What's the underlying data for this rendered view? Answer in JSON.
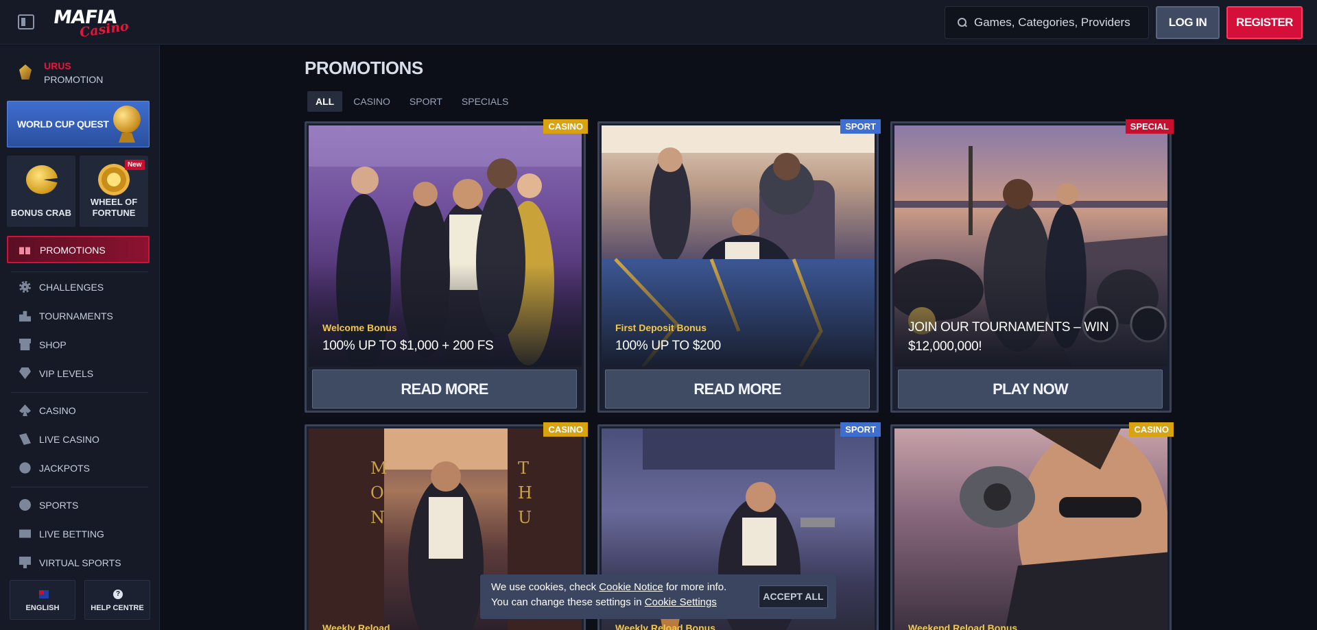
{
  "header": {
    "logo_main": "MAFIA",
    "logo_sub": "Casino",
    "search_placeholder": "Games, Categories, Providers",
    "login_label": "LOG IN",
    "register_label": "REGISTER"
  },
  "sidebar": {
    "urus_line1": "URUS",
    "urus_line2": "PROMOTION",
    "world_cup_quest": "WORLD CUP QUEST",
    "bonus_crab": "BONUS CRAB",
    "wheel_of_fortune_1": "WHEEL OF",
    "wheel_of_fortune_2": "FORTUNE",
    "new_badge": "New",
    "promotions": "PROMOTIONS",
    "items": [
      {
        "label": "CHALLENGES",
        "icon": "gear-icon"
      },
      {
        "label": "TOURNAMENTS",
        "icon": "podium-icon"
      },
      {
        "label": "SHOP",
        "icon": "shop-icon"
      },
      {
        "label": "VIP LEVELS",
        "icon": "diamond-icon"
      },
      {
        "label": "CASINO",
        "icon": "spade-icon"
      },
      {
        "label": "LIVE CASINO",
        "icon": "cards-icon"
      },
      {
        "label": "JACKPOTS",
        "icon": "clover-icon"
      },
      {
        "label": "SPORTS",
        "icon": "soccer-ball-icon"
      },
      {
        "label": "LIVE BETTING",
        "icon": "live-tv-icon"
      },
      {
        "label": "VIRTUAL SPORTS",
        "icon": "monitor-icon"
      }
    ],
    "language": "ENGLISH",
    "help": "HELP CENTRE",
    "help_glyph": "?"
  },
  "main": {
    "title": "PROMOTIONS",
    "tabs": [
      "ALL",
      "CASINO",
      "SPORT",
      "SPECIALS"
    ],
    "cards": [
      {
        "tag": "CASINO",
        "subtitle": "Welcome Bonus",
        "headline": "100% UP TO $1,000 + 200 FS",
        "cta": "READ MORE"
      },
      {
        "tag": "SPORT",
        "subtitle": "First Deposit Bonus",
        "headline": "100% UP TO $200",
        "cta": "READ MORE"
      },
      {
        "tag": "SPECIAL",
        "subtitle": "",
        "headline": "JOIN OUR TOURNAMENTS – WIN $12,000,000!",
        "cta": "PLAY NOW"
      },
      {
        "tag": "CASINO",
        "subtitle": "Weekly Reload",
        "door_left": "MON",
        "door_right": "THU"
      },
      {
        "tag": "SPORT",
        "subtitle": "Weekly Reload Bonus"
      },
      {
        "tag": "CASINO",
        "subtitle": "Weekend Reload Bonus"
      }
    ]
  },
  "cookie": {
    "text1_pre": "We use cookies, check ",
    "text1_link": "Cookie Notice",
    "text1_post": " for more info.",
    "text2_pre": "You can change these settings in ",
    "text2_link": "Cookie Settings",
    "accept": "ACCEPT ALL"
  },
  "colors": {
    "brand_red": "#d4103a",
    "casino_tag": "#d9a20f",
    "sport_tag": "#3e6ecf",
    "special_tag": "#c7102f"
  }
}
